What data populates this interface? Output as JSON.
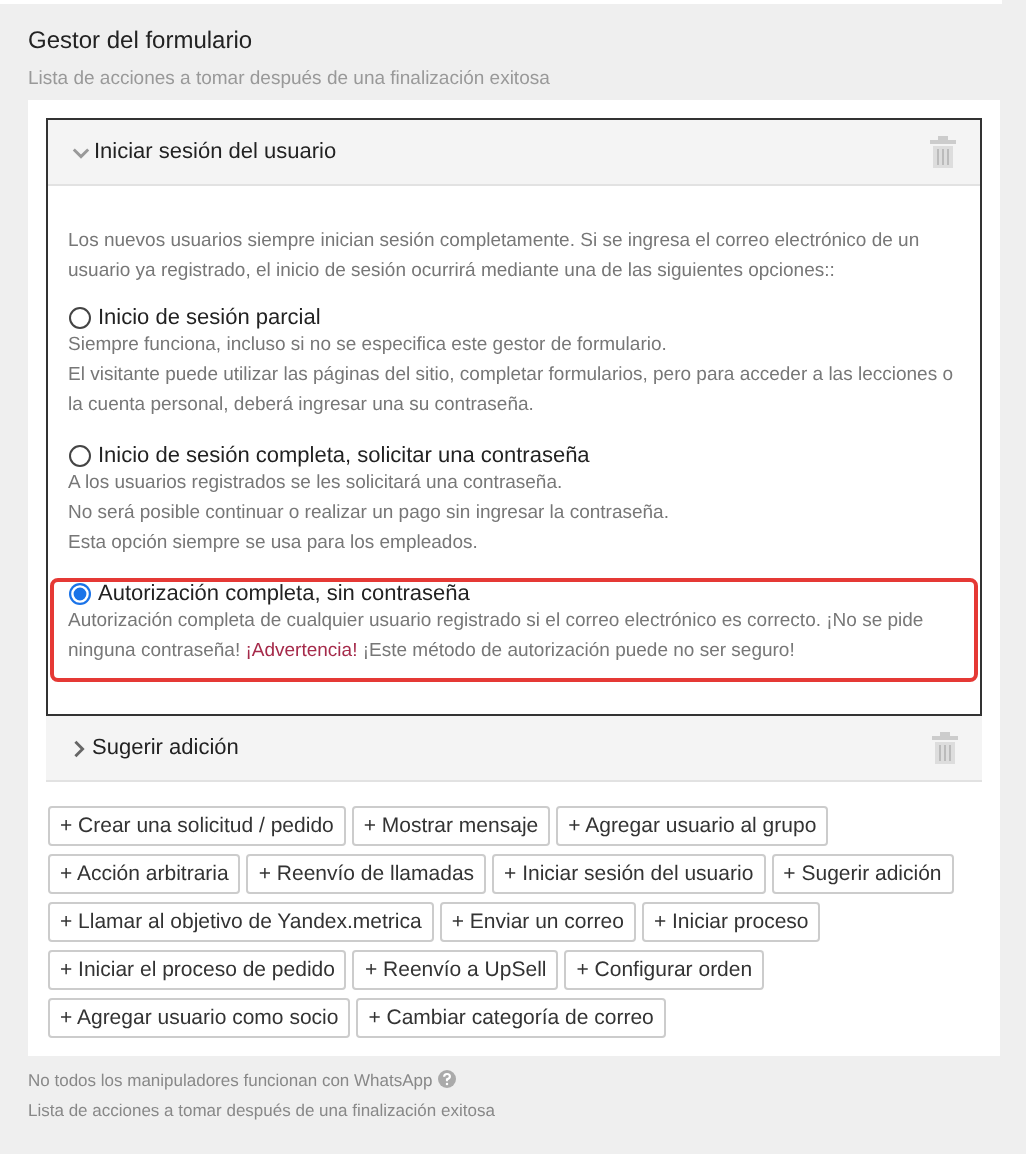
{
  "section": {
    "title": "Gestor del formulario",
    "subtitle": "Lista de acciones a tomar después de una finalización exitosa"
  },
  "handlers": [
    {
      "title": "Iniciar sesión del usuario",
      "expanded": true,
      "intro": "Los nuevos usuarios siempre inician sesión completamente. Si se ingresa el correo electrónico de un usuario ya registrado, el inicio de sesión ocurrirá mediante una de las siguientes opciones::",
      "options": [
        {
          "label": "Inicio de sesión parcial",
          "selected": false,
          "lines": [
            [
              {
                "kind": "plain",
                "text": "Siempre funciona, incluso si no se especifica este gestor de formulario."
              }
            ],
            [
              {
                "kind": "plain",
                "text": "El visitante puede utilizar las páginas del sitio, completar formularios, pero para acceder a las lecciones o la cuenta personal, deberá ingresar una su contraseña."
              }
            ]
          ]
        },
        {
          "label": "Inicio de sesión completa, solicitar una contraseña",
          "selected": false,
          "lines": [
            [
              {
                "kind": "plain",
                "text": "A los usuarios registrados se les solicitará una contraseña."
              }
            ],
            [
              {
                "kind": "plain",
                "text": "No será posible continuar o realizar un pago sin ingresar la contraseña."
              }
            ],
            [
              {
                "kind": "plain",
                "text": "Esta opción siempre se usa para los empleados."
              }
            ]
          ]
        },
        {
          "label": "Autorización completa, sin contraseña",
          "selected": true,
          "lines": [
            [
              {
                "kind": "plain",
                "text": "Autorización completa de cualquier usuario registrado si el correo electrónico es correcto. ¡No se pide ninguna contraseña! "
              },
              {
                "kind": "warning",
                "text": "¡Advertencia!"
              },
              {
                "kind": "plain",
                "text": " ¡Este método de autorización puede no ser seguro!"
              }
            ]
          ]
        }
      ]
    },
    {
      "title": "Sugerir adición",
      "expanded": false
    }
  ],
  "add_buttons": [
    "+ Crear una solicitud / pedido",
    "+ Mostrar mensaje",
    "+ Agregar usuario al grupo",
    "+ Acción arbitraria",
    "+ Reenvío de llamadas",
    "+ Iniciar sesión del usuario",
    "+ Sugerir adición",
    "+ Llamar al objetivo de Yandex.metrica",
    "+ Enviar un correo",
    "+ Iniciar proceso",
    "+ Iniciar el proceso de pedido",
    "+ Reenvío a UpSell",
    "+ Configurar orden",
    "+ Agregar usuario como socio",
    "+ Cambiar categoría de correo"
  ],
  "notes": [
    {
      "text": "No todos los manipuladores funcionan con WhatsApp",
      "help": true
    },
    {
      "text": "Lista de acciones a tomar después de una finalización exitosa",
      "help": false
    }
  ]
}
